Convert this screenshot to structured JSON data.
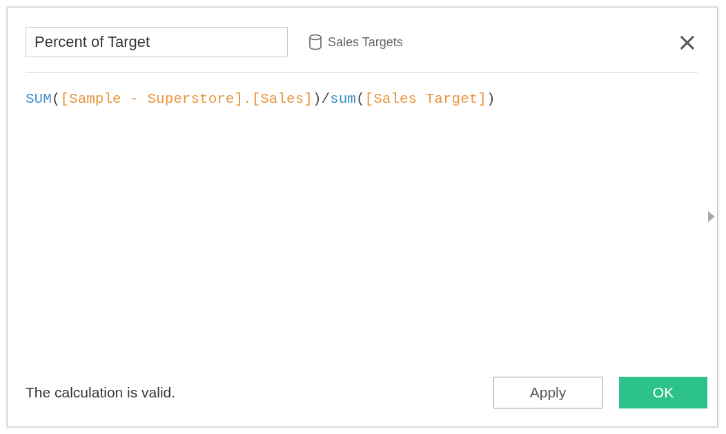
{
  "dialog": {
    "name_field": {
      "value": "Percent of Target"
    },
    "data_source": "Sales Targets",
    "close": "×"
  },
  "formula": [
    {
      "kind": "function",
      "text": "SUM"
    },
    {
      "kind": "operator",
      "text": "("
    },
    {
      "kind": "field",
      "text": "[Sample - Superstore].[Sales]"
    },
    {
      "kind": "operator",
      "text": ")/"
    },
    {
      "kind": "function",
      "text": "sum"
    },
    {
      "kind": "operator",
      "text": "("
    },
    {
      "kind": "field",
      "text": "[Sales Target]"
    },
    {
      "kind": "operator",
      "text": ")"
    }
  ],
  "status": "The calculation is valid.",
  "buttons": [
    {
      "kind": "secondary",
      "label": "Apply"
    },
    {
      "kind": "primary",
      "label": "OK"
    }
  ]
}
